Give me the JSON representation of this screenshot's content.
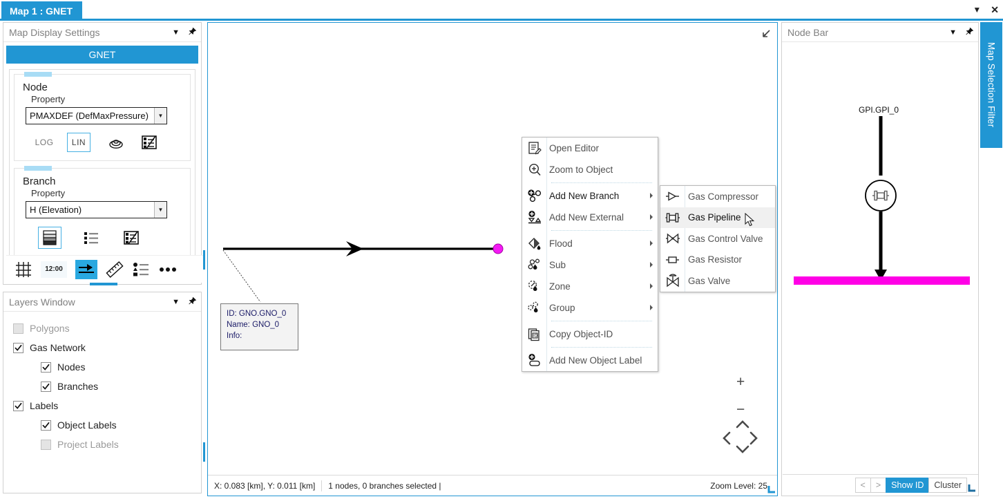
{
  "window": {
    "tab_label": "Map 1 : GNET",
    "dropdown_icon": "chevron-down-icon",
    "close_icon": "close-icon"
  },
  "map_display_settings": {
    "title": "Map Display Settings",
    "menu_icon": "chevron-down-icon",
    "pin_icon": "pin-icon",
    "network_label": "GNET",
    "node": {
      "group_title": "Node",
      "property_label": "Property",
      "property_value": "PMAXDEF (DefMaxPressure)",
      "scale_log": "LOG",
      "scale_lin": "LIN",
      "icon_contour": "contour-icon",
      "icon_legend": "legend-edit-icon"
    },
    "branch": {
      "group_title": "Branch",
      "property_label": "Property",
      "property_value": "H (Elevation)",
      "icon_gradient": "gradient-bands-icon",
      "icon_list": "list-icon",
      "icon_legend": "legend-edit-icon"
    },
    "toolbar": [
      {
        "name": "grid-icon",
        "label": ""
      },
      {
        "name": "time-icon",
        "label": "12:00"
      },
      {
        "name": "flow-arrow-icon",
        "label": ""
      },
      {
        "name": "ruler-icon",
        "label": ""
      },
      {
        "name": "legend-list-icon",
        "label": ""
      },
      {
        "name": "more-icon",
        "label": ""
      }
    ]
  },
  "layers_window": {
    "title": "Layers Window",
    "menu_icon": "chevron-down-icon",
    "pin_icon": "pin-icon",
    "items": [
      {
        "label": "Polygons",
        "checked": false,
        "enabled": false,
        "indent": 0
      },
      {
        "label": "Gas Network",
        "checked": true,
        "enabled": true,
        "indent": 0
      },
      {
        "label": "Nodes",
        "checked": true,
        "enabled": true,
        "indent": 1
      },
      {
        "label": "Branches",
        "checked": true,
        "enabled": true,
        "indent": 1
      },
      {
        "label": "Labels",
        "checked": true,
        "enabled": true,
        "indent": 0
      },
      {
        "label": "Object Labels",
        "checked": true,
        "enabled": true,
        "indent": 1
      },
      {
        "label": "Project Labels",
        "checked": false,
        "enabled": false,
        "indent": 1
      }
    ]
  },
  "map": {
    "resize_icon": "resize-collapse-icon",
    "tooltip": {
      "id_line": "ID: GNO.GNO_0",
      "name_line": "Name: GNO_0",
      "info_line": "Info:"
    },
    "nav": {
      "zoom_in": "+",
      "zoom_out": "−",
      "up": "⌃",
      "down": "⌄",
      "left": "‹",
      "right": "›"
    },
    "status": {
      "coordinates": "X: 0.083 [km], Y: 0.011 [km]",
      "selection": "1 nodes, 0 branches selected  |",
      "zoom_level": "Zoom Level: 25"
    }
  },
  "context_menu": {
    "items": [
      {
        "label": "Open Editor",
        "icon": "open-editor-icon",
        "submenu": false,
        "highlight": false
      },
      {
        "label": "Zoom to Object",
        "icon": "zoom-to-object-icon",
        "submenu": false,
        "highlight": false
      },
      {
        "separator_after": true
      },
      {
        "label": "Add New Branch",
        "icon": "add-branch-icon",
        "submenu": true,
        "highlight": true
      },
      {
        "label": "Add New External",
        "icon": "add-external-icon",
        "submenu": true,
        "highlight": false
      },
      {
        "separator_after": true
      },
      {
        "label": "Flood",
        "icon": "flood-icon",
        "submenu": true,
        "highlight": false
      },
      {
        "label": "Sub",
        "icon": "sub-icon",
        "submenu": true,
        "highlight": false
      },
      {
        "label": "Zone",
        "icon": "zone-icon",
        "submenu": true,
        "highlight": false
      },
      {
        "label": "Group",
        "icon": "group-icon",
        "submenu": true,
        "highlight": false
      },
      {
        "separator_after": true
      },
      {
        "label": "Copy Object-ID",
        "icon": "copy-id-icon",
        "submenu": false,
        "highlight": false
      },
      {
        "separator_after": true
      },
      {
        "label": "Add New Object Label",
        "icon": "add-object-label-icon",
        "submenu": false,
        "highlight": false
      }
    ]
  },
  "branch_submenu": {
    "items": [
      {
        "label": "Gas Compressor",
        "icon": "gas-compressor-icon",
        "hover": false
      },
      {
        "label": "Gas Pipeline",
        "icon": "gas-pipeline-icon",
        "hover": true
      },
      {
        "label": "Gas Control Valve",
        "icon": "gas-control-valve-icon",
        "hover": false
      },
      {
        "label": "Gas Resistor",
        "icon": "gas-resistor-icon",
        "hover": false
      },
      {
        "label": "Gas Valve",
        "icon": "gas-valve-icon",
        "hover": false
      }
    ]
  },
  "node_bar": {
    "title": "Node Bar",
    "menu_icon": "chevron-down-icon",
    "pin_icon": "pin-icon",
    "object_label": "GPI.GPI_0",
    "device_icon": "gas-pipeline-icon",
    "buttons": [
      {
        "label": "<",
        "style": "dim"
      },
      {
        "label": ">",
        "style": "dim"
      },
      {
        "label": "Show ID",
        "style": "primary"
      },
      {
        "label": "Cluster",
        "style": "normal"
      }
    ]
  },
  "side_tab": {
    "label": "Map Selection Filter"
  },
  "colors": {
    "accent": "#2196d3",
    "accent_light": "#29a8e0",
    "magenta": "#ff00e6",
    "panel_title": "#808080",
    "tooltip_text": "#1a1a66"
  }
}
